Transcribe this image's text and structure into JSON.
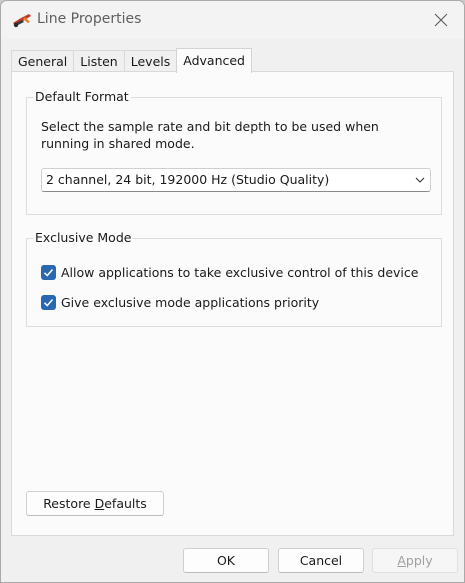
{
  "window": {
    "title": "Line Properties",
    "icon": "speaker-line-icon"
  },
  "tabs": [
    {
      "label": "General"
    },
    {
      "label": "Listen"
    },
    {
      "label": "Levels"
    },
    {
      "label": "Advanced",
      "active": true
    }
  ],
  "default_format": {
    "legend": "Default Format",
    "description": "Select the sample rate and bit depth to be used when running in shared mode.",
    "selected_format": "2 channel, 24 bit, 192000 Hz (Studio Quality)"
  },
  "exclusive_mode": {
    "legend": "Exclusive Mode",
    "allow_exclusive": {
      "label": "Allow applications to take exclusive control of this device",
      "checked": true
    },
    "priority": {
      "label": "Give exclusive mode applications priority",
      "checked": true
    }
  },
  "buttons": {
    "restore_prefix": "Restore ",
    "restore_underlined": "D",
    "restore_suffix": "efaults",
    "ok": "OK",
    "cancel": "Cancel",
    "apply_underlined": "A",
    "apply_suffix": "pply"
  },
  "colors": {
    "accent": "#2a67b3",
    "disabled_text": "#a0a0a0"
  }
}
